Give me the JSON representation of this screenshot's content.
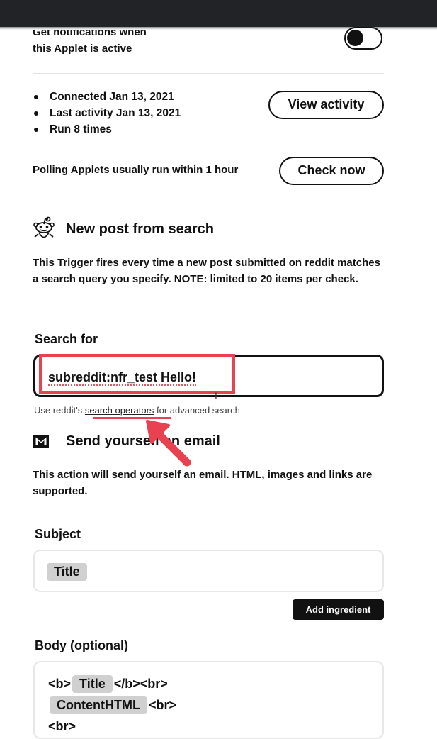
{
  "notifications": {
    "label_line1": "Get notifications when",
    "label_line2": "this Applet is active",
    "toggle_on": true
  },
  "status": {
    "items": [
      "Connected Jan 13, 2021",
      "Last activity Jan 13, 2021",
      "Run 8 times"
    ],
    "view_activity_label": "View activity",
    "polling_text": "Polling Applets usually run within 1 hour",
    "check_now_label": "Check now"
  },
  "trigger": {
    "icon": "reddit-icon",
    "title": "New post from search",
    "description": "This Trigger fires every time a new post submitted on reddit matches a search query you specify. NOTE: limited to 20 items per check.",
    "search_label": "Search for",
    "search_value": "subreddit:nfr_test Hello!",
    "hint_prefix": "Use reddit's ",
    "hint_link": "search operators",
    "hint_suffix": " for advanced search"
  },
  "action": {
    "icon": "gmail-icon",
    "title": "Send yourself an email",
    "description": "This action will send yourself an email. HTML, images and links are supported.",
    "subject_label": "Subject",
    "subject_chip": "Title",
    "add_ingredient_label": "Add ingredient",
    "body_label": "Body (optional)",
    "body_line1_prefix": "<b>",
    "body_line1_chip": "Title",
    "body_line1_suffix": "</b><br>",
    "body_line2_chip": "ContentHTML",
    "body_line2_suffix": "<br>",
    "body_line3": "<br>"
  },
  "colors": {
    "accent_annotation": "#e8414f",
    "topbar": "#222327"
  }
}
